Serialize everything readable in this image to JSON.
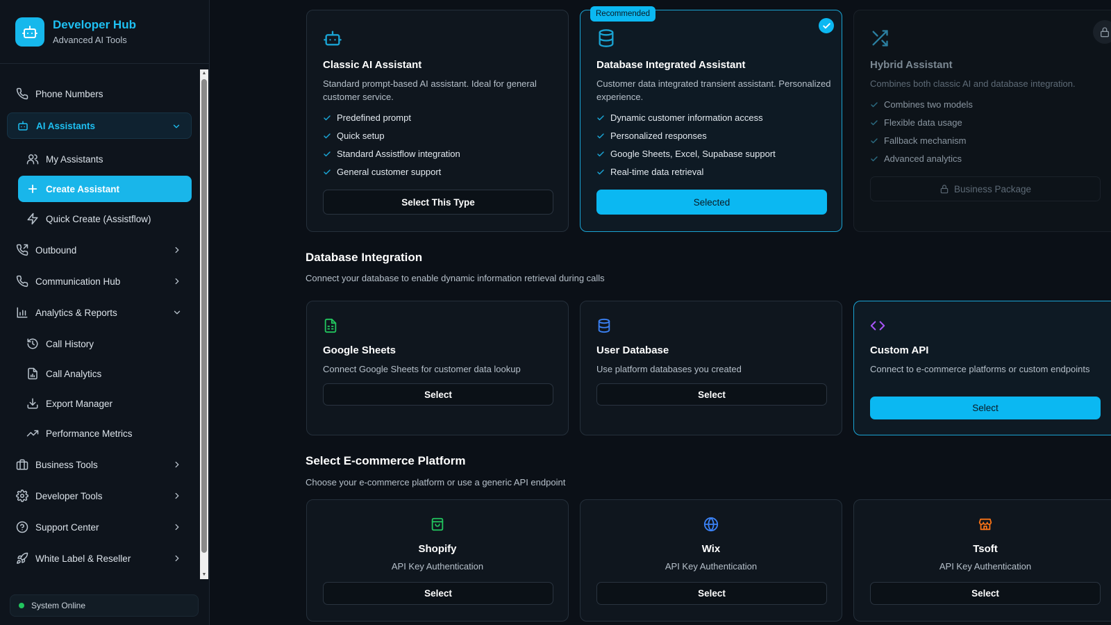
{
  "brand": {
    "title": "Developer Hub",
    "subtitle": "Advanced AI Tools"
  },
  "sidebar": {
    "items": [
      {
        "label": "Phone Numbers",
        "icon": "phone-icon"
      },
      {
        "label": "AI Assistants",
        "icon": "robot-icon",
        "expanded": true
      },
      {
        "label": "My Assistants",
        "icon": "users-icon"
      },
      {
        "label": "Create Assistant",
        "icon": "plus-icon",
        "active": true
      },
      {
        "label": "Quick Create (Assistflow)",
        "icon": "bolt-icon"
      },
      {
        "label": "Outbound",
        "icon": "phone-outgoing-icon"
      },
      {
        "label": "Communication Hub",
        "icon": "phone-icon"
      },
      {
        "label": "Analytics & Reports",
        "icon": "bar-chart-icon",
        "expanded": true
      },
      {
        "label": "Call History",
        "icon": "history-icon"
      },
      {
        "label": "Call Analytics",
        "icon": "file-chart-icon"
      },
      {
        "label": "Export Manager",
        "icon": "download-icon"
      },
      {
        "label": "Performance Metrics",
        "icon": "trend-icon"
      },
      {
        "label": "Business Tools",
        "icon": "briefcase-icon"
      },
      {
        "label": "Developer Tools",
        "icon": "gear-icon"
      },
      {
        "label": "Support Center",
        "icon": "help-icon"
      },
      {
        "label": "White Label & Reseller",
        "icon": "rocket-icon"
      }
    ],
    "status": "System Online"
  },
  "assistant_types": [
    {
      "title": "Classic AI Assistant",
      "description": "Standard prompt-based AI assistant. Ideal for general customer service.",
      "features": [
        "Predefined prompt",
        "Quick setup",
        "Standard Assistflow integration",
        "General customer support"
      ],
      "button": "Select This Type"
    },
    {
      "badge": "Recommended",
      "title": "Database Integrated Assistant",
      "description": "Customer data integrated transient assistant. Personalized experience.",
      "features": [
        "Dynamic customer information access",
        "Personalized responses",
        "Google Sheets, Excel, Supabase support",
        "Real-time data retrieval"
      ],
      "button": "Selected"
    },
    {
      "title": "Hybrid Assistant",
      "description": "Combines both classic AI and database integration.",
      "features": [
        "Combines two models",
        "Flexible data usage",
        "Fallback mechanism",
        "Advanced analytics"
      ],
      "button": "Business Package"
    }
  ],
  "database_section": {
    "title": "Database Integration",
    "subtitle": "Connect your database to enable dynamic information retrieval during calls",
    "options": [
      {
        "title": "Google Sheets",
        "description": "Connect Google Sheets for customer data lookup",
        "button": "Select"
      },
      {
        "title": "User Database",
        "description": "Use platform databases you created",
        "button": "Select"
      },
      {
        "title": "Custom API",
        "description": "Connect to e-commerce platforms or custom endpoints",
        "button": "Select"
      }
    ]
  },
  "ecommerce_section": {
    "title": "Select E-commerce Platform",
    "subtitle": "Choose your e-commerce platform or use a generic API endpoint",
    "platforms": [
      {
        "name": "Shopify",
        "auth": "API Key Authentication",
        "button": "Select"
      },
      {
        "name": "Wix",
        "auth": "API Key Authentication",
        "button": "Select"
      },
      {
        "name": "Tsoft",
        "auth": "API Key Authentication",
        "button": "Select"
      }
    ]
  },
  "colors": {
    "accent": "#0bb8f2",
    "background": "#0b1017",
    "card": "#0f161e",
    "online": "#22c55e"
  }
}
